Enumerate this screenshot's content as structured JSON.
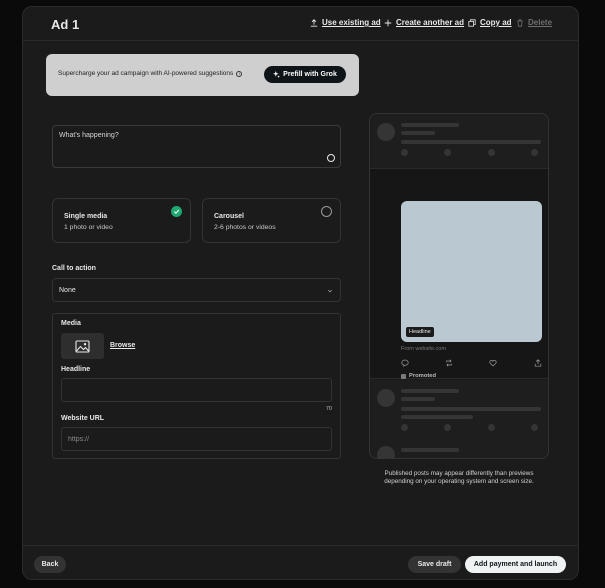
{
  "header": {
    "title": "Ad 1",
    "actions": {
      "use_existing": "Use existing ad",
      "create_another": "Create another ad",
      "copy": "Copy ad",
      "delete": "Delete"
    }
  },
  "promo": {
    "text": "Supercharge your ad campaign with AI-powered suggestions",
    "info_icon": "i",
    "button_label": "Prefill with Grok"
  },
  "composer": {
    "placeholder": "What's happening?",
    "value": ""
  },
  "media_type": {
    "options": [
      {
        "title": "Single media",
        "subtitle": "1 photo or video",
        "selected": true
      },
      {
        "title": "Carousel",
        "subtitle": "2-6 photos or videos",
        "selected": false
      }
    ]
  },
  "cta": {
    "label": "Call to action",
    "selected": "None"
  },
  "media_box": {
    "media_label": "Media",
    "browse_label": "Browse",
    "headline_label": "Headline",
    "headline_value": "",
    "headline_counter": "70",
    "url_label": "Website URL",
    "url_placeholder": "https://"
  },
  "preview": {
    "headline_overlay": "Headline",
    "from_text": "From website.com",
    "promoted_label": "Promoted",
    "disclaimer": "Published posts may appear differently than previews depending on your operating system and screen size."
  },
  "footer": {
    "back_label": "Back",
    "save_draft_label": "Save draft",
    "launch_label": "Add payment and launch"
  },
  "colors": {
    "accent_check": "#1fa971",
    "preview_image": "#b9c8d1",
    "primary_button": "#eff3f4"
  }
}
